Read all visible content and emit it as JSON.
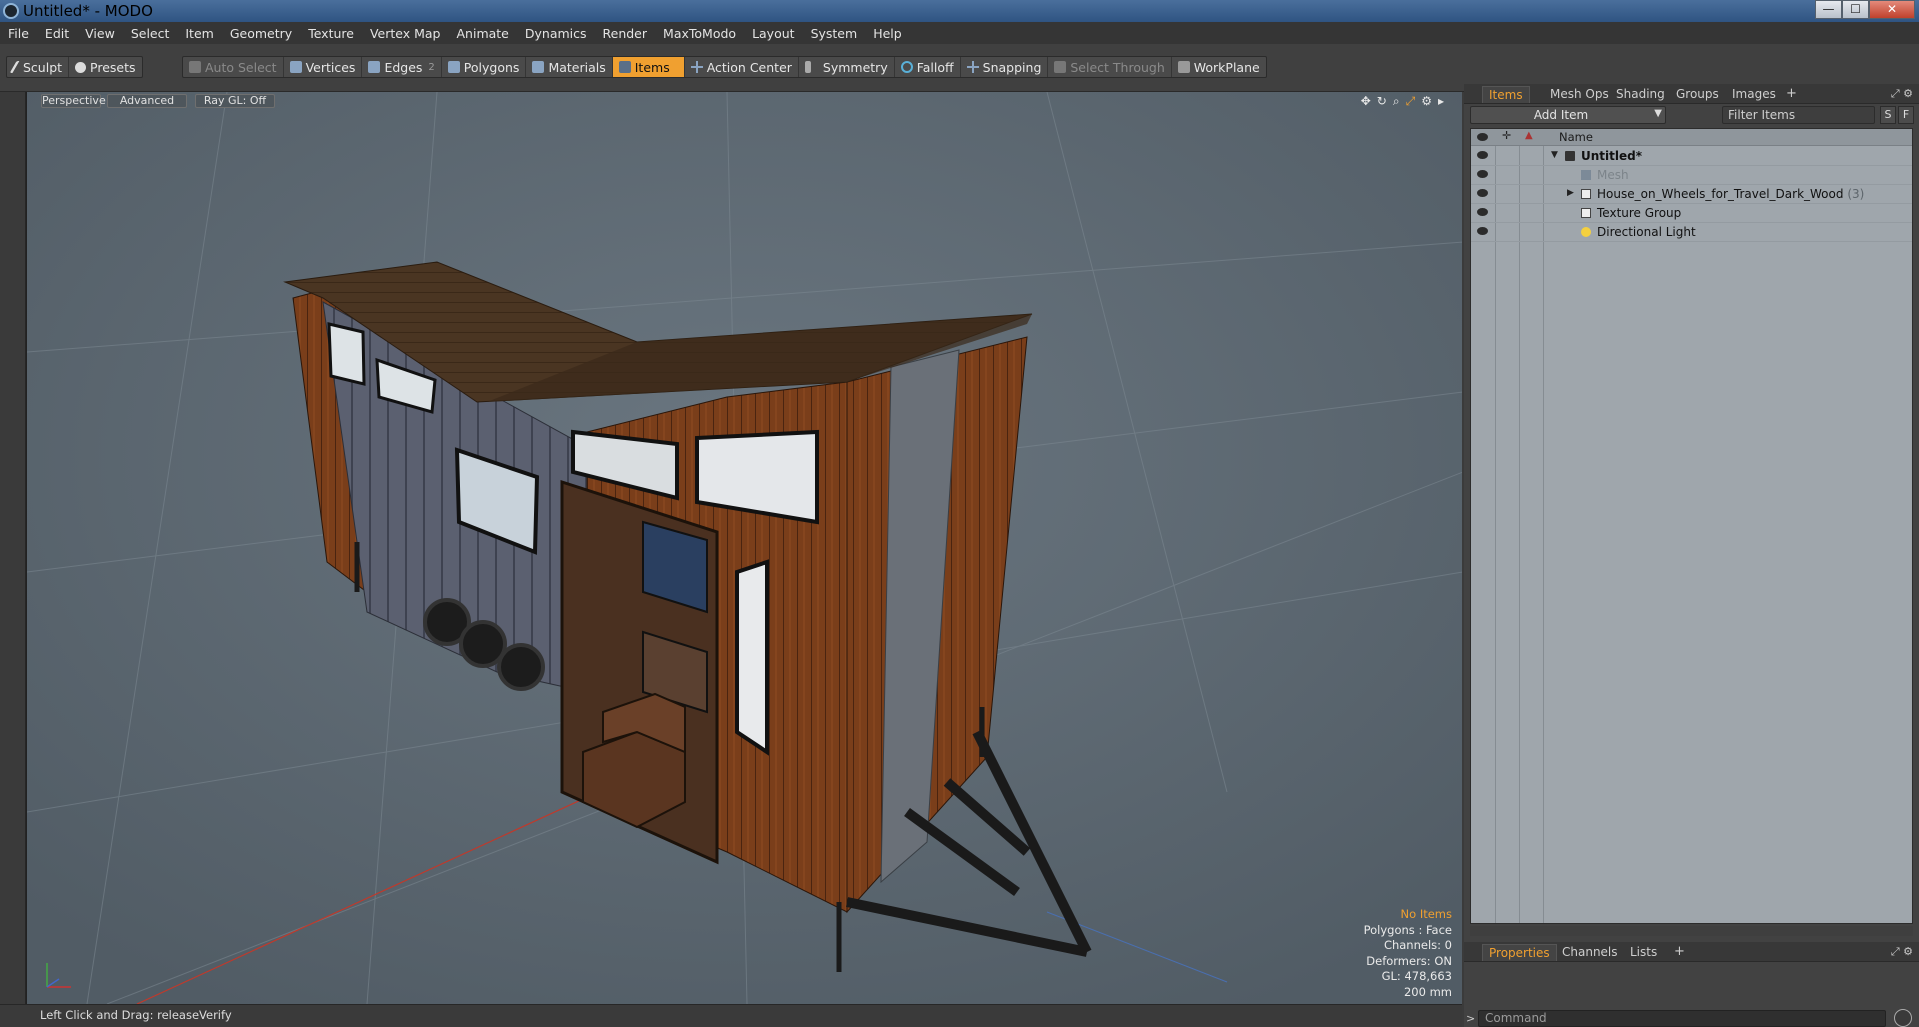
{
  "window": {
    "title": "Untitled* - MODO",
    "min": "—",
    "max": "☐",
    "close": "✕"
  },
  "menu": [
    "File",
    "Edit",
    "View",
    "Select",
    "Item",
    "Geometry",
    "Texture",
    "Vertex Map",
    "Animate",
    "Dynamics",
    "Render",
    "MaxToModo",
    "Layout",
    "System",
    "Help"
  ],
  "toolbar": {
    "sculpt": "Sculpt",
    "presets": "Presets",
    "auto_select": "Auto Select",
    "vertices": "Vertices",
    "edges": "Edges",
    "edges_count": "2",
    "polygons": "Polygons",
    "materials": "Materials",
    "items": "Items",
    "action_center": "Action Center",
    "symmetry": "Symmetry",
    "falloff": "Falloff",
    "snapping": "Snapping",
    "select_through": "Select Through",
    "workplane": "WorkPlane"
  },
  "viewport": {
    "tabs": [
      "Perspective",
      "Advanced",
      "Ray GL: Off"
    ],
    "hud": {
      "selection": "No Items",
      "polygons": "Polygons : Face",
      "channels": "Channels: 0",
      "deformers": "Deformers: ON",
      "gl": "GL: 478,663",
      "scale": "200 mm"
    }
  },
  "status": {
    "text": "Left Click and Drag:  releaseVerify"
  },
  "items_panel": {
    "tabs": [
      "Items",
      "Mesh Ops",
      "Shading",
      "Groups",
      "Images"
    ],
    "plus": "+",
    "add_item": "Add Item",
    "filter_placeholder": "Filter Items",
    "s_btn": "S",
    "f_btn": "F",
    "column_name": "Name",
    "rows": [
      {
        "label": "Untitled*",
        "count": ""
      },
      {
        "label": "Mesh",
        "count": ""
      },
      {
        "label": "House_on_Wheels_for_Travel_Dark_Wood",
        "count": "(3)"
      },
      {
        "label": "Texture Group",
        "count": ""
      },
      {
        "label": "Directional Light",
        "count": ""
      }
    ]
  },
  "properties_panel": {
    "tabs": [
      "Properties",
      "Channels",
      "Lists"
    ],
    "plus": "+",
    "command_placeholder": "Command",
    "prompt": ">"
  },
  "colors": {
    "accent": "#f0a030",
    "viewport_bg": "#5e6a74",
    "item_list_bg": "#9fa6ac"
  }
}
